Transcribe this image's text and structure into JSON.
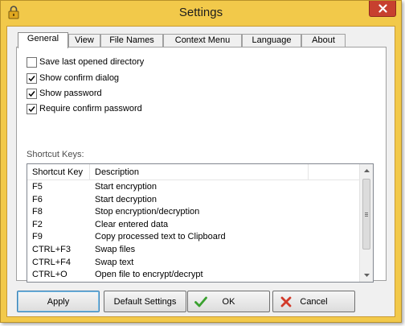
{
  "window": {
    "title": "Settings"
  },
  "tabs": [
    {
      "label": "General",
      "active": true
    },
    {
      "label": "View",
      "active": false
    },
    {
      "label": "File Names",
      "active": false
    },
    {
      "label": "Context Menu",
      "active": false
    },
    {
      "label": "Language",
      "active": false
    },
    {
      "label": "About",
      "active": false
    }
  ],
  "options": [
    {
      "label": "Save last opened directory",
      "checked": false
    },
    {
      "label": "Show confirm dialog",
      "checked": true
    },
    {
      "label": "Show password",
      "checked": true
    },
    {
      "label": "Require confirm password",
      "checked": true
    }
  ],
  "shortcuts": {
    "label": "Shortcut Keys:",
    "columns": [
      "Shortcut Key",
      "Description"
    ],
    "rows": [
      [
        "F5",
        "Start encryption"
      ],
      [
        "F6",
        "Start decryption"
      ],
      [
        "F8",
        "Stop encryption/decryption"
      ],
      [
        "F2",
        "Clear entered data"
      ],
      [
        "F9",
        "Copy processed text to Clipboard"
      ],
      [
        "CTRL+F3",
        "Swap files"
      ],
      [
        "CTRL+F4",
        "Swap text"
      ],
      [
        "CTRL+O",
        "Open file to encrypt/decrypt"
      ]
    ]
  },
  "buttons": {
    "apply": "Apply",
    "default_settings": "Default Settings",
    "ok": "OK",
    "cancel": "Cancel"
  },
  "colors": {
    "titlebar": "#f2c94a",
    "close": "#c7402f",
    "ok_check": "#3aa12f",
    "cancel_x": "#d23a2a"
  }
}
